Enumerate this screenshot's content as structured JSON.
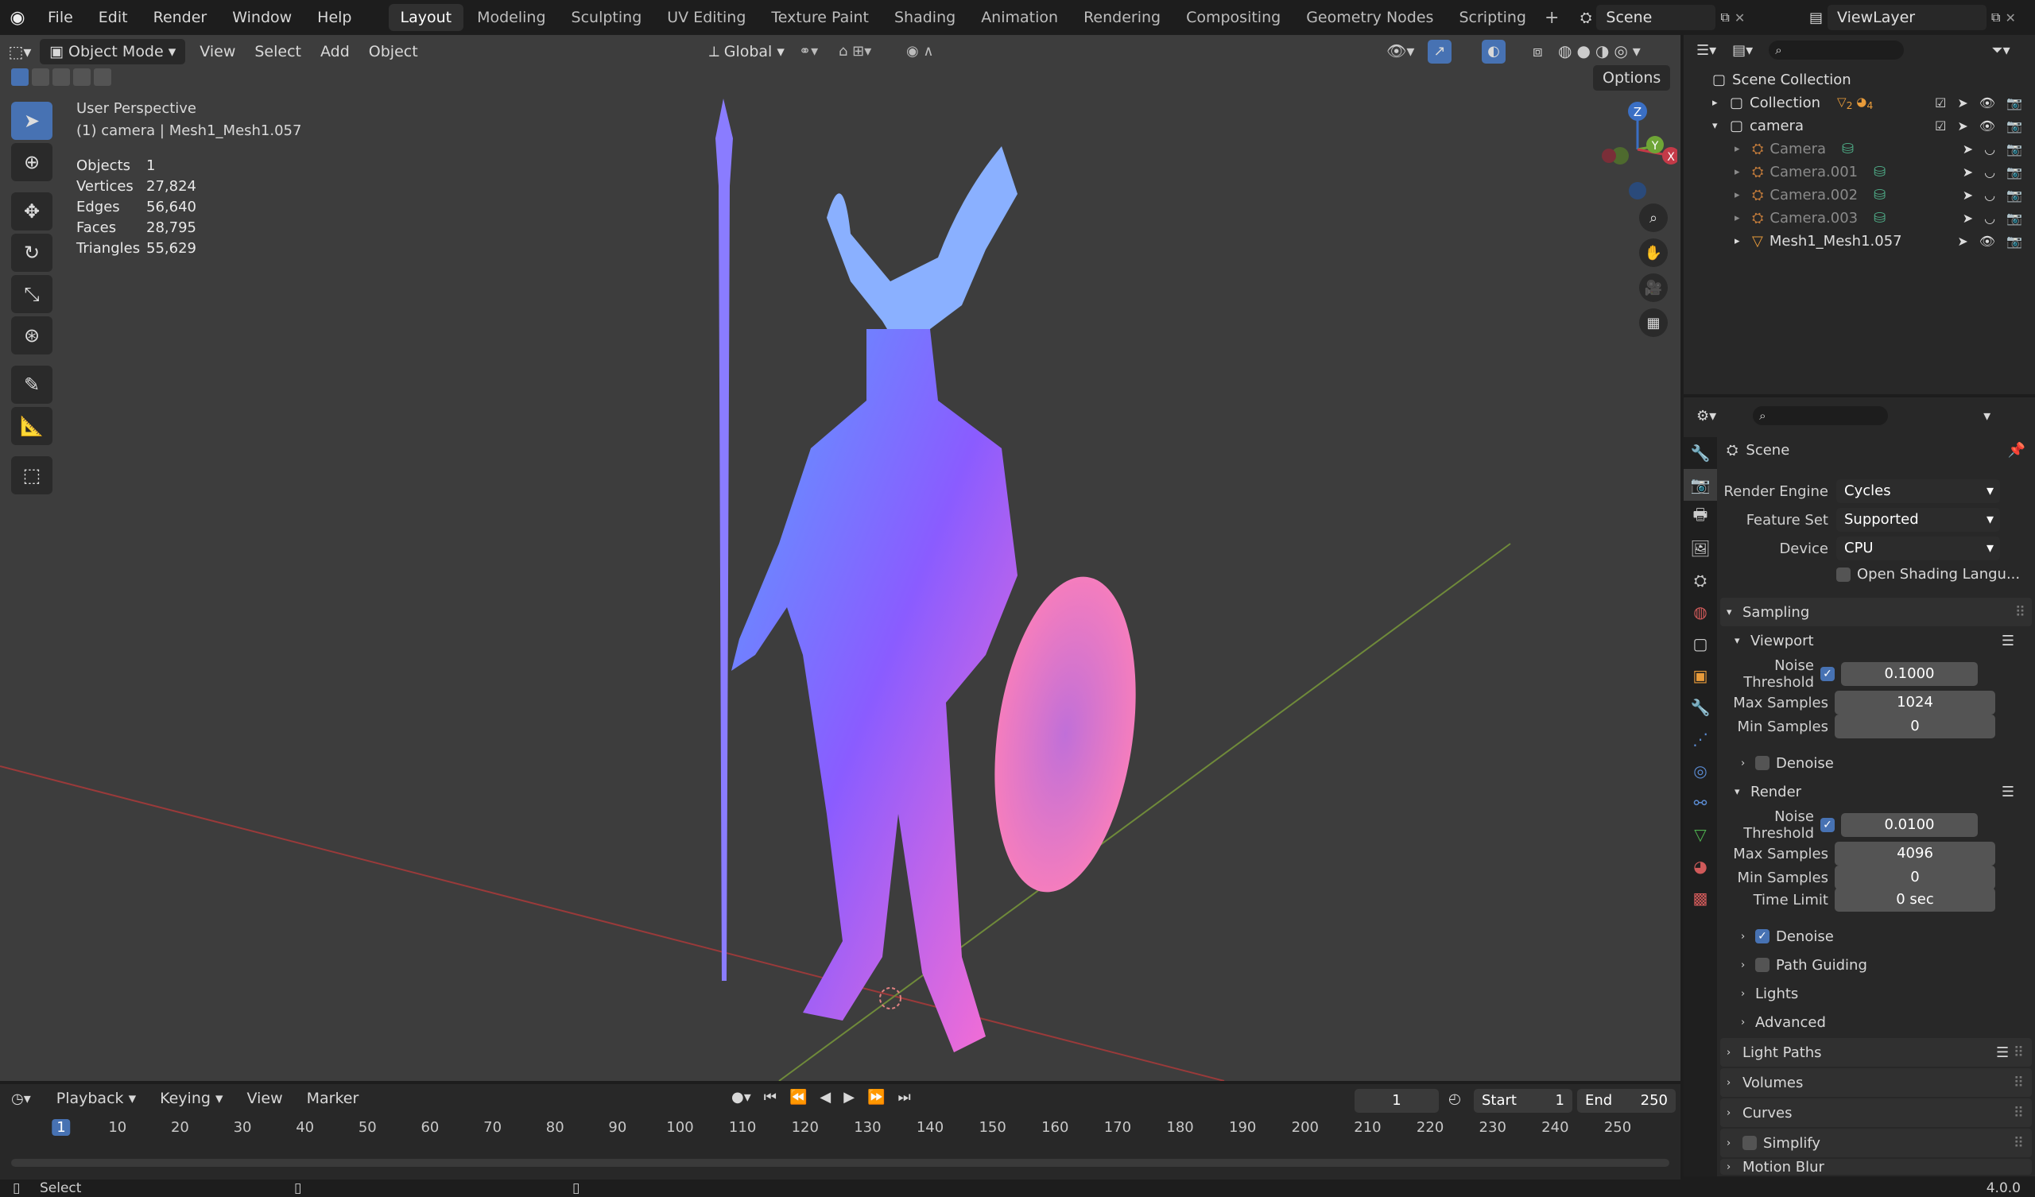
{
  "menu": {
    "file": "File",
    "edit": "Edit",
    "render": "Render",
    "window": "Window",
    "help": "Help"
  },
  "workspaces": [
    "Layout",
    "Modeling",
    "Sculpting",
    "UV Editing",
    "Texture Paint",
    "Shading",
    "Animation",
    "Rendering",
    "Compositing",
    "Geometry Nodes",
    "Scripting"
  ],
  "active_workspace": "Layout",
  "scene_name": "Scene",
  "view_layer": "ViewLayer",
  "viewport": {
    "mode": "Object Mode",
    "menus": [
      "View",
      "Select",
      "Add",
      "Object"
    ],
    "orientation": "Global",
    "options": "Options",
    "overlay_title": "User Perspective",
    "overlay_sub": "(1) camera | Mesh1_Mesh1.057",
    "stats": [
      {
        "k": "Objects",
        "v": "1"
      },
      {
        "k": "Vertices",
        "v": "27,824"
      },
      {
        "k": "Edges",
        "v": "56,640"
      },
      {
        "k": "Faces",
        "v": "28,795"
      },
      {
        "k": "Triangles",
        "v": "55,629"
      }
    ],
    "gizmo": {
      "z": "Z",
      "y": "Y",
      "x": "X"
    }
  },
  "outliner": {
    "root": "Scene Collection",
    "collection": "Collection",
    "collection_badge1": "2",
    "collection_badge2": "4",
    "camera_collection": "camera",
    "items": [
      "Camera",
      "Camera.001",
      "Camera.002",
      "Camera.003",
      "Mesh1_Mesh1.057"
    ]
  },
  "properties": {
    "context": "Scene",
    "render_engine_label": "Render Engine",
    "render_engine": "Cycles",
    "feature_set_label": "Feature Set",
    "feature_set": "Supported",
    "device_label": "Device",
    "device": "CPU",
    "osl": "Open Shading Langu...",
    "sampling": "Sampling",
    "viewport": "Viewport",
    "noise_threshold": "Noise Threshold",
    "vp_noise": "0.1000",
    "max_samples": "Max Samples",
    "vp_max": "1024",
    "min_samples": "Min Samples",
    "vp_min": "0",
    "denoise": "Denoise",
    "render": "Render",
    "r_noise": "0.0100",
    "r_max": "4096",
    "r_min": "0",
    "time_limit": "Time Limit",
    "r_time": "0 sec",
    "path_guiding": "Path Guiding",
    "lights": "Lights",
    "advanced": "Advanced",
    "light_paths": "Light Paths",
    "volumes": "Volumes",
    "curves": "Curves",
    "simplify": "Simplify",
    "motion_blur": "Motion Blur"
  },
  "timeline": {
    "menus": [
      "Playback",
      "Keying",
      "View",
      "Marker"
    ],
    "current_frame": "1",
    "start_label": "Start",
    "start": "1",
    "end_label": "End",
    "end": "250",
    "ticks": [
      "1",
      "10",
      "20",
      "30",
      "40",
      "50",
      "60",
      "70",
      "80",
      "90",
      "100",
      "110",
      "120",
      "130",
      "140",
      "150",
      "160",
      "170",
      "180",
      "190",
      "200",
      "210",
      "220",
      "230",
      "240",
      "250"
    ]
  },
  "status": {
    "select": "Select",
    "version": "4.0.0"
  }
}
